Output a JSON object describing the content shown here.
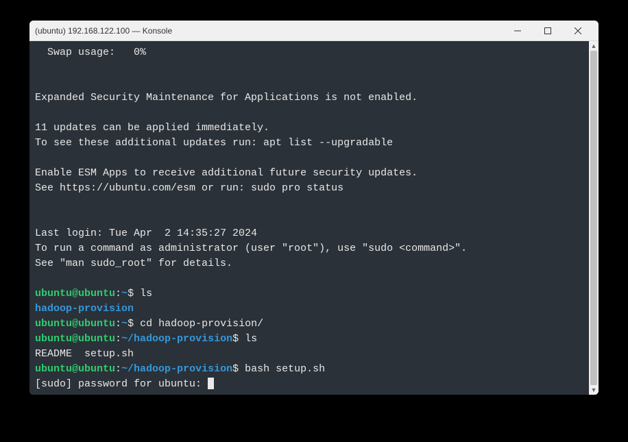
{
  "window": {
    "title": "(ubuntu) 192.168.122.100 — Konsole"
  },
  "terminal": {
    "motd": {
      "swap_line": "  Swap usage:   0%",
      "blank1": "",
      "blank2": "",
      "esm_line": "Expanded Security Maintenance for Applications is not enabled.",
      "blank3": "",
      "updates_line1": "11 updates can be applied immediately.",
      "updates_line2": "To see these additional updates run: apt list --upgradable",
      "blank4": "",
      "esm_enable1": "Enable ESM Apps to receive additional future security updates.",
      "esm_enable2": "See https://ubuntu.com/esm or run: sudo pro status",
      "blank5": "",
      "blank6": "",
      "last_login": "Last login: Tue Apr  2 14:35:27 2024",
      "sudo_hint1": "To run a command as administrator (user \"root\"), use \"sudo <command>\".",
      "sudo_hint2": "See \"man sudo_root\" for details.",
      "blank7": ""
    },
    "prompts": {
      "user_host": "ubuntu@ubuntu",
      "home_path": "~",
      "provision_path": "~/hadoop-provision",
      "dollar": "$",
      "colon": ":"
    },
    "commands": {
      "ls1": " ls",
      "ls_output1": "hadoop-provision",
      "cd": " cd hadoop-provision/",
      "ls2": " ls",
      "ls_output2": "README  setup.sh",
      "bash": " bash setup.sh",
      "sudo_prompt": "[sudo] password for ubuntu: "
    }
  }
}
